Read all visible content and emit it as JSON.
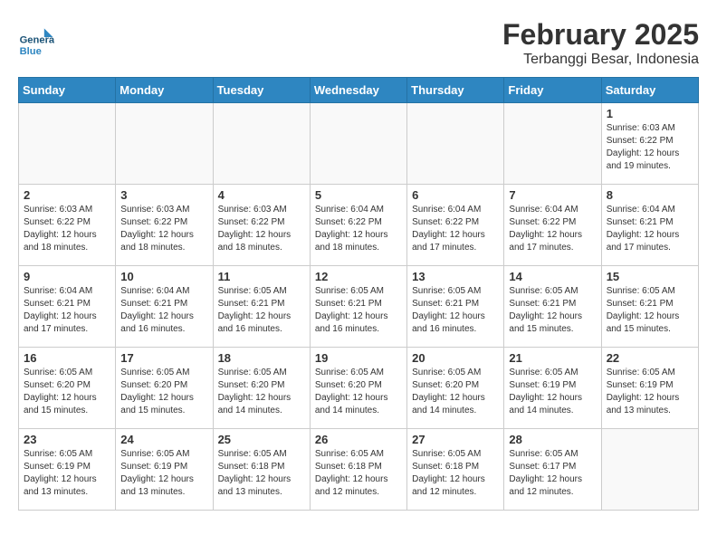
{
  "header": {
    "logo_general": "General",
    "logo_blue": "Blue",
    "main_title": "February 2025",
    "subtitle": "Terbanggi Besar, Indonesia"
  },
  "days_of_week": [
    "Sunday",
    "Monday",
    "Tuesday",
    "Wednesday",
    "Thursday",
    "Friday",
    "Saturday"
  ],
  "weeks": [
    [
      {
        "day": "",
        "info": ""
      },
      {
        "day": "",
        "info": ""
      },
      {
        "day": "",
        "info": ""
      },
      {
        "day": "",
        "info": ""
      },
      {
        "day": "",
        "info": ""
      },
      {
        "day": "",
        "info": ""
      },
      {
        "day": "1",
        "info": "Sunrise: 6:03 AM\nSunset: 6:22 PM\nDaylight: 12 hours\nand 19 minutes."
      }
    ],
    [
      {
        "day": "2",
        "info": "Sunrise: 6:03 AM\nSunset: 6:22 PM\nDaylight: 12 hours\nand 18 minutes."
      },
      {
        "day": "3",
        "info": "Sunrise: 6:03 AM\nSunset: 6:22 PM\nDaylight: 12 hours\nand 18 minutes."
      },
      {
        "day": "4",
        "info": "Sunrise: 6:03 AM\nSunset: 6:22 PM\nDaylight: 12 hours\nand 18 minutes."
      },
      {
        "day": "5",
        "info": "Sunrise: 6:04 AM\nSunset: 6:22 PM\nDaylight: 12 hours\nand 18 minutes."
      },
      {
        "day": "6",
        "info": "Sunrise: 6:04 AM\nSunset: 6:22 PM\nDaylight: 12 hours\nand 17 minutes."
      },
      {
        "day": "7",
        "info": "Sunrise: 6:04 AM\nSunset: 6:22 PM\nDaylight: 12 hours\nand 17 minutes."
      },
      {
        "day": "8",
        "info": "Sunrise: 6:04 AM\nSunset: 6:21 PM\nDaylight: 12 hours\nand 17 minutes."
      }
    ],
    [
      {
        "day": "9",
        "info": "Sunrise: 6:04 AM\nSunset: 6:21 PM\nDaylight: 12 hours\nand 17 minutes."
      },
      {
        "day": "10",
        "info": "Sunrise: 6:04 AM\nSunset: 6:21 PM\nDaylight: 12 hours\nand 16 minutes."
      },
      {
        "day": "11",
        "info": "Sunrise: 6:05 AM\nSunset: 6:21 PM\nDaylight: 12 hours\nand 16 minutes."
      },
      {
        "day": "12",
        "info": "Sunrise: 6:05 AM\nSunset: 6:21 PM\nDaylight: 12 hours\nand 16 minutes."
      },
      {
        "day": "13",
        "info": "Sunrise: 6:05 AM\nSunset: 6:21 PM\nDaylight: 12 hours\nand 16 minutes."
      },
      {
        "day": "14",
        "info": "Sunrise: 6:05 AM\nSunset: 6:21 PM\nDaylight: 12 hours\nand 15 minutes."
      },
      {
        "day": "15",
        "info": "Sunrise: 6:05 AM\nSunset: 6:21 PM\nDaylight: 12 hours\nand 15 minutes."
      }
    ],
    [
      {
        "day": "16",
        "info": "Sunrise: 6:05 AM\nSunset: 6:20 PM\nDaylight: 12 hours\nand 15 minutes."
      },
      {
        "day": "17",
        "info": "Sunrise: 6:05 AM\nSunset: 6:20 PM\nDaylight: 12 hours\nand 15 minutes."
      },
      {
        "day": "18",
        "info": "Sunrise: 6:05 AM\nSunset: 6:20 PM\nDaylight: 12 hours\nand 14 minutes."
      },
      {
        "day": "19",
        "info": "Sunrise: 6:05 AM\nSunset: 6:20 PM\nDaylight: 12 hours\nand 14 minutes."
      },
      {
        "day": "20",
        "info": "Sunrise: 6:05 AM\nSunset: 6:20 PM\nDaylight: 12 hours\nand 14 minutes."
      },
      {
        "day": "21",
        "info": "Sunrise: 6:05 AM\nSunset: 6:19 PM\nDaylight: 12 hours\nand 14 minutes."
      },
      {
        "day": "22",
        "info": "Sunrise: 6:05 AM\nSunset: 6:19 PM\nDaylight: 12 hours\nand 13 minutes."
      }
    ],
    [
      {
        "day": "23",
        "info": "Sunrise: 6:05 AM\nSunset: 6:19 PM\nDaylight: 12 hours\nand 13 minutes."
      },
      {
        "day": "24",
        "info": "Sunrise: 6:05 AM\nSunset: 6:19 PM\nDaylight: 12 hours\nand 13 minutes."
      },
      {
        "day": "25",
        "info": "Sunrise: 6:05 AM\nSunset: 6:18 PM\nDaylight: 12 hours\nand 13 minutes."
      },
      {
        "day": "26",
        "info": "Sunrise: 6:05 AM\nSunset: 6:18 PM\nDaylight: 12 hours\nand 12 minutes."
      },
      {
        "day": "27",
        "info": "Sunrise: 6:05 AM\nSunset: 6:18 PM\nDaylight: 12 hours\nand 12 minutes."
      },
      {
        "day": "28",
        "info": "Sunrise: 6:05 AM\nSunset: 6:17 PM\nDaylight: 12 hours\nand 12 minutes."
      },
      {
        "day": "",
        "info": ""
      }
    ]
  ]
}
